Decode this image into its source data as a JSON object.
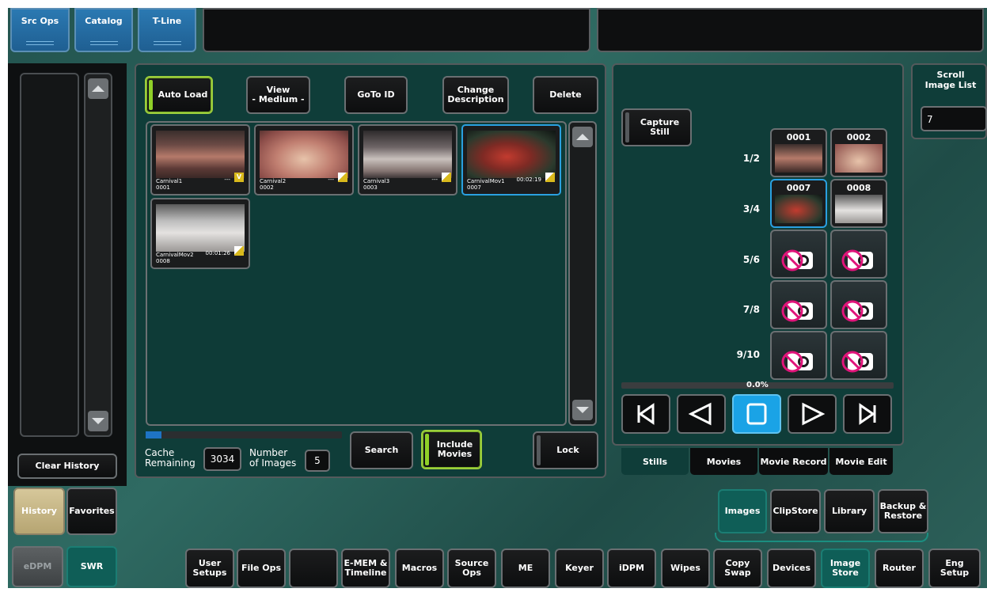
{
  "top_tabs": [
    "Src Ops",
    "Catalog",
    "T-Line"
  ],
  "history": {
    "clear_label": "Clear History",
    "history_label": "History",
    "favorites_label": "Favorites"
  },
  "library": {
    "auto_load": "Auto Load",
    "view": "View\n- Medium -",
    "goto_id": "GoTo ID",
    "change_description": "Change\nDescription",
    "delete": "Delete",
    "thumbnails": [
      {
        "name": "Carnival1",
        "id": "0001",
        "duration": "---",
        "badge": "V"
      },
      {
        "name": "Carnival2",
        "id": "0002",
        "duration": "---",
        "badge": "K"
      },
      {
        "name": "Carnival3",
        "id": "0003",
        "duration": "---",
        "badge": "K"
      },
      {
        "name": "CarnivalMov1",
        "id": "0007",
        "duration": "00:02:19",
        "badge": "K"
      },
      {
        "name": "CarnivalMov2",
        "id": "0008",
        "duration": "00:01:26",
        "badge": "K"
      }
    ],
    "cache_label": "Cache\nRemaining",
    "cache_value": "3034",
    "number_label": "Number\nof Images",
    "number_value": "5",
    "search": "Search",
    "include_movies": "Include\nMovies",
    "lock": "Lock"
  },
  "scroll_list": {
    "title": "Scroll\nImage List",
    "value": "7"
  },
  "capture": {
    "capture_still": "Capture Still",
    "rows": [
      "1/2",
      "3/4",
      "5/6",
      "7/8",
      "9/10"
    ],
    "slots": [
      "0001",
      "0002",
      "0007",
      "0008"
    ],
    "progress": "0.0%",
    "tabs": [
      "Stills",
      "Movies",
      "Movie Record",
      "Movie Edit"
    ]
  },
  "sub_tabs": [
    "Images",
    "ClipStore",
    "Library",
    "Backup &\nRestore"
  ],
  "bottom_modes": [
    "eDPM",
    "SWR"
  ],
  "bottom_menu": [
    "User\nSetups",
    "File Ops",
    "",
    "E-MEM &\nTimeline",
    "Macros",
    "Source\nOps",
    "ME",
    "Keyer",
    "iDPM",
    "Wipes",
    "Copy\nSwap",
    "Devices",
    "Image\nStore",
    "Router",
    "Eng\nSetup"
  ],
  "colors": {
    "accent_green": "#8fcf28",
    "accent_blue": "#2aa0e0",
    "panel_teal": "#0f3d39",
    "active_teal": "#0f5e57"
  }
}
